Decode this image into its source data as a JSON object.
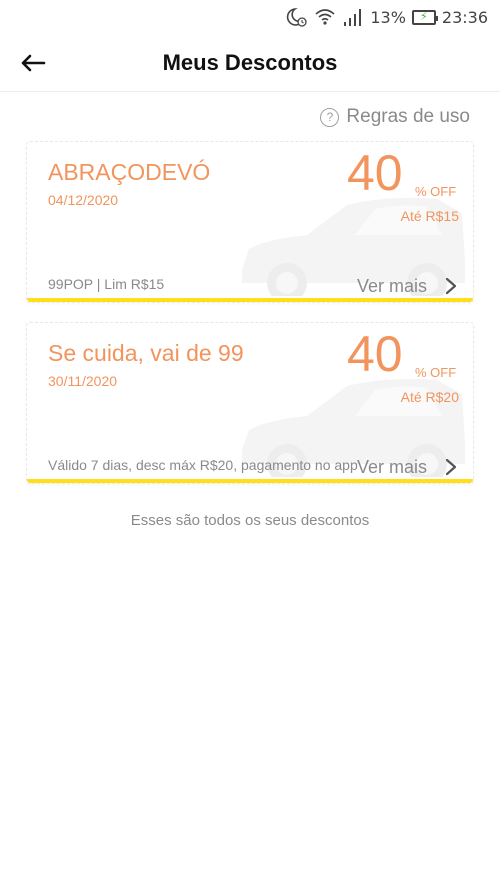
{
  "status_bar": {
    "battery_percent": "13%",
    "time": "23:36",
    "icons": [
      "moon-alarm-icon",
      "wifi-icon",
      "signal-icon",
      "battery-icon"
    ]
  },
  "header": {
    "title": "Meus Descontos",
    "back_icon": "arrow-left-icon"
  },
  "rules": {
    "label": "Regras de uso",
    "icon": "question-circle-icon"
  },
  "coupons": [
    {
      "title": "ABRAÇODEVÓ",
      "date": "04/12/2020",
      "discount": "40",
      "off_label": "% OFF",
      "max": "Até R$15",
      "description": "99POP | Lim R$15",
      "see_more": "Ver mais"
    },
    {
      "title": "Se cuida, vai de 99",
      "date": "30/11/2020",
      "discount": "40",
      "off_label": "% OFF",
      "max": "Até R$20",
      "description": "Válido 7 dias, desc máx R$20, pagamento no app",
      "see_more": "Ver mais"
    }
  ],
  "footer_note": "Esses são todos os seus descontos",
  "colors": {
    "accent_orange": "#f2945d",
    "underline_yellow": "#ffdf1a",
    "muted_text": "#8a8a8a"
  }
}
